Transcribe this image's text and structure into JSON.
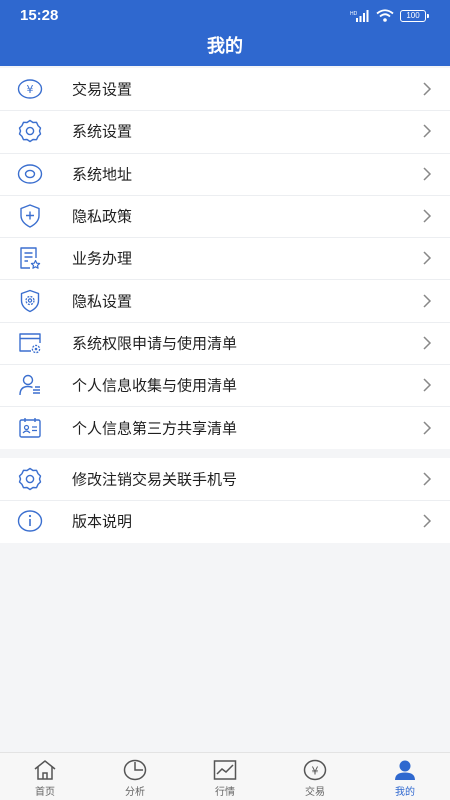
{
  "status_bar": {
    "time": "15:28",
    "battery": "100"
  },
  "header": {
    "title": "我的"
  },
  "menu_group_1": [
    {
      "label": "交易设置",
      "icon": "yuan-circle-icon"
    },
    {
      "label": "系统设置",
      "icon": "gear-icon"
    },
    {
      "label": "系统地址",
      "icon": "location-icon"
    },
    {
      "label": "隐私政策",
      "icon": "shield-plus-icon"
    },
    {
      "label": "业务办理",
      "icon": "document-star-icon"
    },
    {
      "label": "隐私设置",
      "icon": "shield-gear-icon"
    },
    {
      "label": "系统权限申请与使用清单",
      "icon": "window-gear-icon"
    },
    {
      "label": "个人信息收集与使用清单",
      "icon": "user-list-icon"
    },
    {
      "label": "个人信息第三方共享清单",
      "icon": "id-card-icon"
    }
  ],
  "menu_group_2": [
    {
      "label": "修改注销交易关联手机号",
      "icon": "gear-icon"
    },
    {
      "label": "版本说明",
      "icon": "info-icon"
    }
  ],
  "tab_bar": [
    {
      "label": "首页",
      "icon": "home-icon"
    },
    {
      "label": "分析",
      "icon": "pie-chart-icon"
    },
    {
      "label": "行情",
      "icon": "line-chart-icon"
    },
    {
      "label": "交易",
      "icon": "yuan-circle-icon"
    },
    {
      "label": "我的",
      "icon": "user-icon",
      "active": true
    }
  ],
  "colors": {
    "primary": "#2f68cf",
    "icon": "#3b6fcf",
    "text": "#1f1f1f",
    "background": "#f4f5f7"
  }
}
